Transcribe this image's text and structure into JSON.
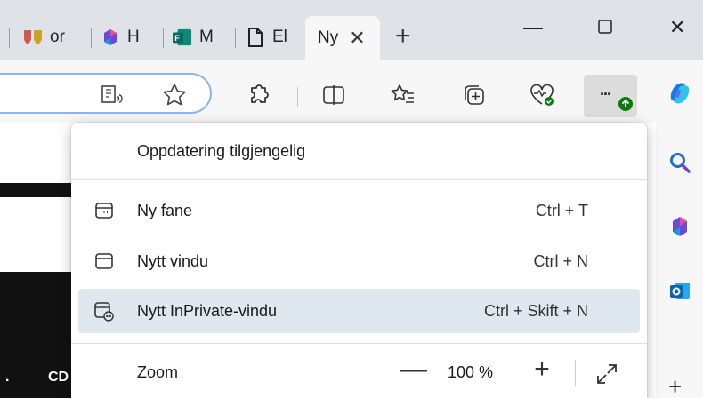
{
  "tabs": [
    {
      "label": "or",
      "icon": "shield-icon"
    },
    {
      "label": "H",
      "icon": "copilot-icon"
    },
    {
      "label": "M",
      "icon": "forms-icon"
    },
    {
      "label": "El",
      "icon": "document-icon"
    }
  ],
  "active_tab": {
    "label": "Ny",
    "close_glyph": "✕"
  },
  "new_tab_glyph": "+",
  "window_controls": {
    "minimize": "—",
    "maximize": "▢",
    "close": "✕"
  },
  "toolbar": {
    "icons": [
      "read-aloud-icon",
      "favorite-star-icon",
      "extensions-icon",
      "split-screen-icon",
      "favorites-list-icon",
      "collections-icon",
      "browser-essentials-icon",
      "more-options-icon"
    ],
    "more_label": "···"
  },
  "sidebar": {
    "icons": [
      "copilot-icon",
      "search-icon",
      "copilot-m365-icon",
      "outlook-icon"
    ],
    "add_glyph": "+"
  },
  "page": {
    "left_text": ".",
    "cd_text": "CD"
  },
  "menu": {
    "update_text": "Oppdatering tilgjengelig",
    "items": [
      {
        "label": "Ny fane",
        "shortcut": "Ctrl + T",
        "icon": "new-tab-icon"
      },
      {
        "label": "Nytt vindu",
        "shortcut": "Ctrl + N",
        "icon": "new-window-icon"
      },
      {
        "label": "Nytt InPrivate-vindu",
        "shortcut": "Ctrl + Skift + N",
        "icon": "inprivate-window-icon"
      }
    ],
    "zoom": {
      "label": "Zoom",
      "minus": "—",
      "value": "100 %",
      "plus": "+"
    }
  },
  "colors": {
    "hover": "#dfe7ef",
    "accent": "#0f6cbd",
    "update_badge": "#0e7a0d"
  }
}
